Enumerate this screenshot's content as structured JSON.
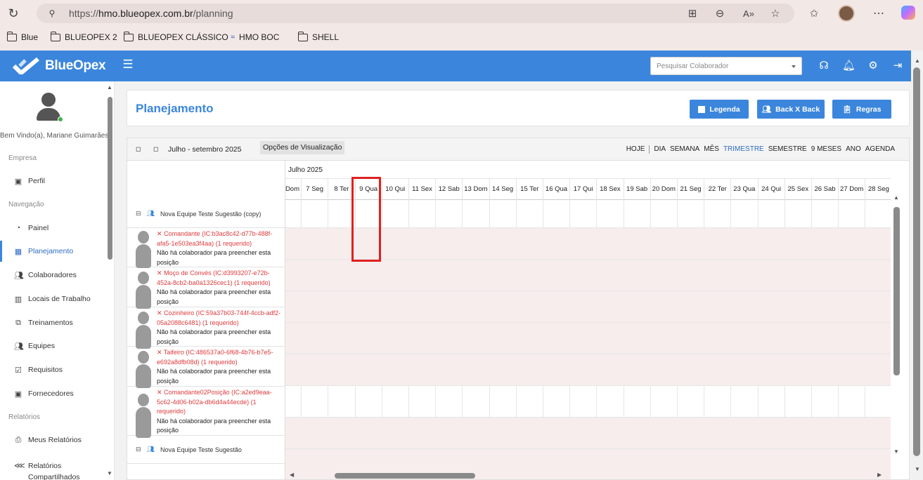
{
  "browser": {
    "url_scheme": "https://",
    "url_domain": "hmo.blueopex.com.br",
    "url_path": "/planning",
    "bookmarks": [
      "Blue",
      "BLUEOPEX 2",
      "BLUEOPEX CLÁSSICO",
      "HMO BOC",
      "SHELL"
    ]
  },
  "app": {
    "logo_text": "BlueOpex",
    "search_placeholder": "Pesquisar Colaborador",
    "brand_color": "#3b86dc"
  },
  "sidebar": {
    "welcome": "Bem Vindo(a), Mariane Guimarães",
    "sections": {
      "empresa": "Empresa",
      "navegacao": "Navegação",
      "relatorios": "Relatórios"
    },
    "items": {
      "perfil": "Perfil",
      "painel": "Painel",
      "planejamento": "Planejamento",
      "colaboradores": "Colaboradores",
      "locais": "Locais de Trabalho",
      "treinamentos": "Treinamentos",
      "equipes": "Equipes",
      "requisitos": "Requisitos",
      "fornecedores": "Fornecedores",
      "meus_relatorios": "Meus Relatórios",
      "relatorios_compartilhados": "Relatórios Compartilhados"
    }
  },
  "header": {
    "title": "Planejamento",
    "buttons": {
      "legenda": "Legenda",
      "backxback": "Back X Back",
      "regras": "Regras"
    }
  },
  "toolbar": {
    "range": "Julho - setembro 2025",
    "view_options": "Opções de Visualização",
    "today": "HOJE",
    "views": [
      "DIA",
      "SEMANA",
      "MÊS",
      "TRIMESTRE",
      "SEMESTRE",
      "9 MESES",
      "ANO",
      "AGENDA"
    ],
    "active_view": "TRIMESTRE"
  },
  "calendar": {
    "month": "Julho 2025",
    "days": [
      "Dom",
      "7 Seg",
      "8 Ter",
      "9 Qua",
      "10 Qui",
      "11 Sex",
      "12 Sab",
      "13 Dom",
      "14 Seg",
      "15 Ter",
      "16 Qua",
      "17 Qui",
      "18 Sex",
      "19 Sab",
      "20 Dom",
      "21 Seg",
      "22 Ter",
      "23 Qua",
      "24 Qui",
      "25 Sex",
      "26 Sab",
      "27 Dom",
      "28 Seg"
    ],
    "highlighted_day": "9 Qua"
  },
  "teams": [
    {
      "name": "Nova Equipe Teste Sugestão (copy)"
    },
    {
      "name": "Nova Equipe Teste Sugestão"
    }
  ],
  "positions": [
    {
      "title": "Comandante (IC:b3ac8c42-d77b-488f-afa5-1e503ea3f4aa) (1 requerido)",
      "note": "Não há colaborador para preencher esta posição"
    },
    {
      "title": "Moço de Convés (IC:d3993207-e72b-452a-8cb2-ba0a1326cec1) (1 requerido)",
      "note": "Não há colaborador para preencher esta posição"
    },
    {
      "title": "Cozinheiro (IC:59a37b03-744f-4ccb-adf2-05a2088c6481) (1 requerido)",
      "note": "Não há colaborador para preencher esta posição"
    },
    {
      "title": "Taifeiro (IC:486537a0-6f68-4b76-b7e5-e692a8dfb08d) (1 requerido)",
      "note": "Não há colaborador para preencher esta posição"
    },
    {
      "title": "Comandante02Posição (IC:a2ed9eaa-5c62-4d06-b02a-db6d4a44ecde) (1 requerido)",
      "note": "Não há colaborador para preencher esta posição"
    }
  ],
  "position_marker": "✕"
}
